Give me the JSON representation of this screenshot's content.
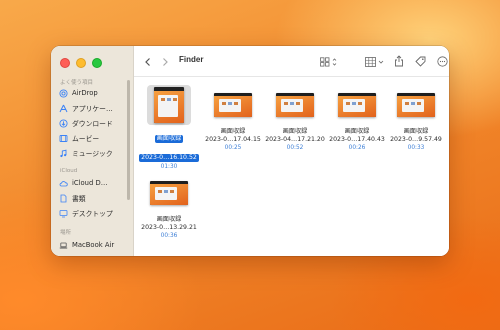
{
  "window": {
    "title": "Finder"
  },
  "colors": {
    "accent": "#1a6bd8",
    "duration": "#3d7fd6",
    "sidebar_bg": "#ece6da"
  },
  "sidebar": {
    "favorites_header": "よく使う項目",
    "favorites": [
      {
        "label": "AirDrop",
        "icon": "airdrop-icon"
      },
      {
        "label": "アプリケー…",
        "icon": "applications-icon"
      },
      {
        "label": "ダウンロード",
        "icon": "downloads-icon"
      },
      {
        "label": "ムービー",
        "icon": "movies-icon"
      },
      {
        "label": "ミュージック",
        "icon": "music-icon"
      }
    ],
    "icloud_header": "iCloud",
    "icloud": [
      {
        "label": "iCloud D…",
        "icon": "icloud-drive-icon"
      },
      {
        "label": "書類",
        "icon": "documents-icon"
      },
      {
        "label": "デスクトップ",
        "icon": "desktop-icon"
      }
    ],
    "locations_header": "場所",
    "locations": [
      {
        "label": "MacBook Air",
        "icon": "laptop-icon"
      }
    ]
  },
  "files": [
    {
      "name": "画面収録",
      "date": "2023-0…16.10.52",
      "duration": "01:30",
      "selected": true,
      "portrait": true
    },
    {
      "name": "画面収録",
      "date": "2023-0…17.04.15",
      "duration": "00:25",
      "selected": false,
      "portrait": false
    },
    {
      "name": "画面収録",
      "date": "2023-04…17.21.20",
      "duration": "00:52",
      "selected": false,
      "portrait": false
    },
    {
      "name": "画面収録",
      "date": "2023-0…17.40.43",
      "duration": "00:26",
      "selected": false,
      "portrait": false
    },
    {
      "name": "画面収録",
      "date": "2023-0…9.57.49",
      "duration": "00:33",
      "selected": false,
      "portrait": false
    },
    {
      "name": "画面収録",
      "date": "2023-0…13.29.21",
      "duration": "00:36",
      "selected": false,
      "portrait": false
    }
  ]
}
